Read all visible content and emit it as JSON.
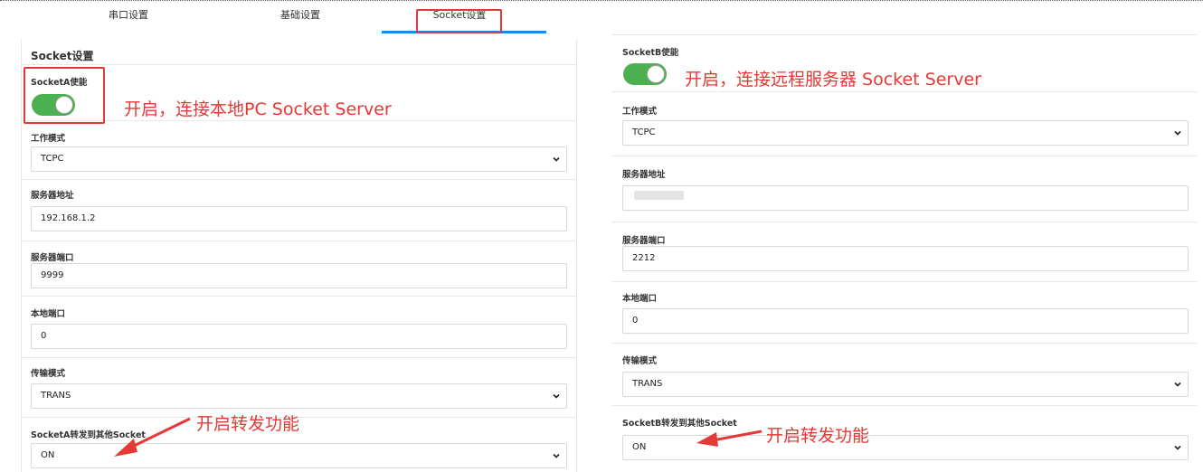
{
  "tabs": [
    {
      "label": "串口设置"
    },
    {
      "label": "基础设置"
    },
    {
      "label": "Socket设置"
    }
  ],
  "left": {
    "section_title": "Socket设置",
    "enable_label": "SocketA使能",
    "enable_state": "on",
    "annotation_enable": "开启，连接本地PC Socket Server",
    "work_mode_label": "工作模式",
    "work_mode_value": "TCPC",
    "server_addr_label": "服务器地址",
    "server_addr_value": "192.168.1.2",
    "server_port_label": "服务器端口",
    "server_port_value": "9999",
    "local_port_label": "本地端口",
    "local_port_value": "0",
    "trans_mode_label": "传输模式",
    "trans_mode_value": "TRANS",
    "forward_label": "SocketA转发到其他Socket",
    "forward_value": "ON",
    "annotation_forward": "开启转发功能"
  },
  "right": {
    "enable_label": "SocketB使能",
    "enable_state": "on",
    "annotation_enable": "开启，连接远程服务器 Socket Server",
    "work_mode_label": "工作模式",
    "work_mode_value": "TCPC",
    "server_addr_label": "服务器地址",
    "server_addr_value": "",
    "server_port_label": "服务器端口",
    "server_port_value": "2212",
    "local_port_label": "本地端口",
    "local_port_value": "0",
    "trans_mode_label": "传输模式",
    "trans_mode_value": "TRANS",
    "forward_label": "SocketB转发到其他Socket",
    "forward_value": "ON",
    "annotation_forward": "开启转发功能"
  },
  "colors": {
    "accent": "#1e88e5",
    "annotation": "#e53935",
    "toggle_on": "#4caf50"
  },
  "icons": [
    "chevron-down-icon",
    "red-arrow-icon"
  ]
}
